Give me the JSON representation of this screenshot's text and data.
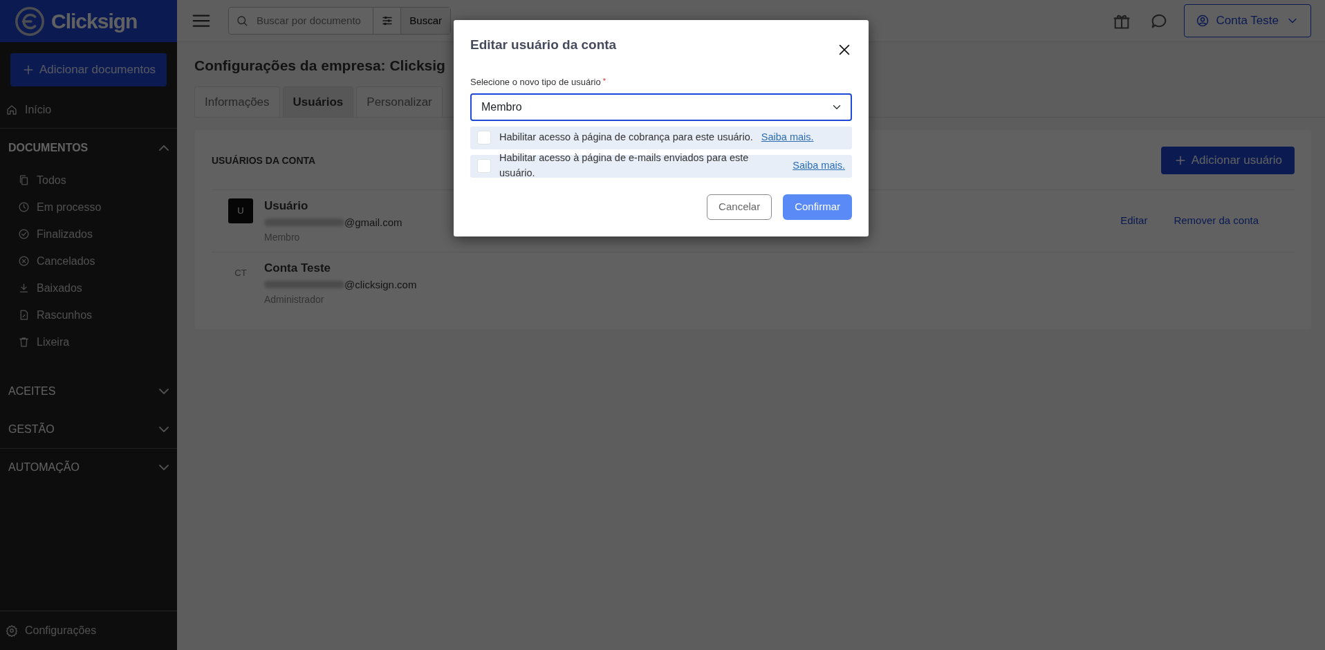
{
  "sidebar": {
    "logo": "Clicksign",
    "add_button": "Adicionar documentos",
    "home": "Início",
    "sections": [
      {
        "title": "DOCUMENTOS",
        "expanded": true,
        "items": [
          {
            "label": "Todos",
            "kind": "copies"
          },
          {
            "label": "Em processo",
            "kind": "clock"
          },
          {
            "label": "Finalizados",
            "kind": "check"
          },
          {
            "label": "Cancelados",
            "kind": "cancel"
          },
          {
            "label": "Baixados",
            "kind": "download"
          },
          {
            "label": "Rascunhos",
            "kind": "draft"
          },
          {
            "label": "Lixeira",
            "kind": "trash"
          }
        ]
      },
      {
        "title": "ACEITES",
        "expanded": false
      },
      {
        "title": "GESTÃO",
        "expanded": false
      },
      {
        "title": "AUTOMAÇÃO",
        "expanded": false
      }
    ],
    "footer": "Configurações"
  },
  "topbar": {
    "search": {
      "placeholder": "Buscar por documento"
    },
    "search_button": "Buscar",
    "account": "Conta Teste"
  },
  "page": {
    "title": "Configurações da empresa: Clicksig",
    "tabs": [
      {
        "label": "Informações",
        "selected": false
      },
      {
        "label": "Usuários",
        "selected": true
      },
      {
        "label": "Personalizar",
        "selected": false
      }
    ],
    "card": {
      "title": "USUÁRIOS DA CONTA",
      "add_button": "Adicionar usuário",
      "users": [
        {
          "initials": "U",
          "kind": "filled",
          "name": "Usuário",
          "email": "@gmail.com",
          "role": "Membro",
          "actions": [
            "Editar",
            "Remover da conta"
          ]
        },
        {
          "initials": "CT",
          "kind": "plain",
          "name": "Conta Teste",
          "email": "@clicksign.com",
          "role": "Administrador"
        }
      ]
    }
  },
  "modal": {
    "title": "Editar usuário da conta",
    "field_label": "Selecione o novo tipo de usuário",
    "required_mark": "*",
    "select_value": "Membro",
    "options": [
      {
        "label": "Habilitar acesso à página de cobrança para este usuário.",
        "link": "Saiba mais.",
        "checked": false
      },
      {
        "label": "Habilitar acesso à página de e-mails enviados para este usuário.",
        "link": "Saiba mais.",
        "checked": false
      }
    ],
    "cancel": "Cancelar",
    "confirm": "Confirmar"
  }
}
